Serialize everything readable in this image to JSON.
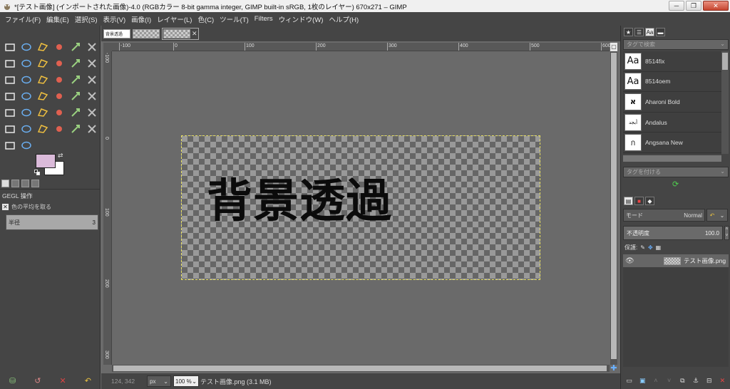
{
  "window": {
    "title": "*[テスト画像] (インポートされた画像)-4.0 (RGBカラー 8-bit gamma integer, GIMP built-in sRGB, 1枚のレイヤー) 670x271 – GIMP",
    "minimize": "─",
    "maximize": "❐",
    "close": "✕"
  },
  "menu": [
    "ファイル(F)",
    "編集(E)",
    "選択(S)",
    "表示(V)",
    "画像(I)",
    "レイヤー(L)",
    "色(C)",
    "ツール(T)",
    "Filters",
    "ウィンドウ(W)",
    "ヘルプ(H)"
  ],
  "toolbox": {
    "tools": [
      "rect-select",
      "ellipse-select",
      "free-select",
      "fuzzy-select",
      "select-by-color",
      "scissors",
      "foreground-select",
      "paths",
      "color-picker",
      "zoom",
      "measure",
      "move",
      "align",
      "crop",
      "rotate",
      "scale",
      "shear",
      "perspective",
      "unified-transform",
      "handle-transform",
      "warp-transform",
      "flip",
      "cage-transform",
      "text",
      "bucket-fill",
      "blend",
      "pencil",
      "paintbrush",
      "eraser",
      "airbrush",
      "ink",
      "mypaint-brush",
      "clone",
      "heal",
      "perspective-clone",
      "blur",
      "smudge",
      "dodge-burn"
    ],
    "fg_color": "#dbbbda",
    "bg_color": "#ffffff",
    "options_title": "GEGL 操作",
    "option_check_label": "色の平均を取る",
    "radius_label": "半径",
    "radius_value": "3"
  },
  "image_tabs": {
    "first_thumb_text": "背景透過",
    "close": "✕"
  },
  "rulers": {
    "h": [
      "-100",
      "0",
      "100",
      "200",
      "300",
      "400",
      "500",
      "600",
      "700",
      "800"
    ],
    "v": [
      "-100",
      "0",
      "100",
      "200",
      "300",
      "400"
    ]
  },
  "canvas": {
    "text": "背景透過"
  },
  "status": {
    "coords": "124, 342",
    "unit": "px",
    "zoom": "100 %",
    "message": "テスト画像.png (3.1 MB)"
  },
  "fonts": {
    "tag_filter_placeholder": "タグで検索",
    "tag_assign_placeholder": "タグを付ける",
    "items": [
      {
        "preview": "Aa",
        "name": "8514fix"
      },
      {
        "preview": "Aa",
        "name": "8514oem"
      },
      {
        "preview": "א",
        "name": "Aharoni Bold"
      },
      {
        "preview": "أبجد",
        "name": "Andalus"
      },
      {
        "preview": "ก",
        "name": "Angsana New"
      }
    ]
  },
  "layers": {
    "mode_label": "モード",
    "mode_value": "Normal",
    "opacity_label": "不透明度",
    "opacity_value": "100.0",
    "lock_label": "保護:",
    "layer_name": "テスト画像.png"
  }
}
